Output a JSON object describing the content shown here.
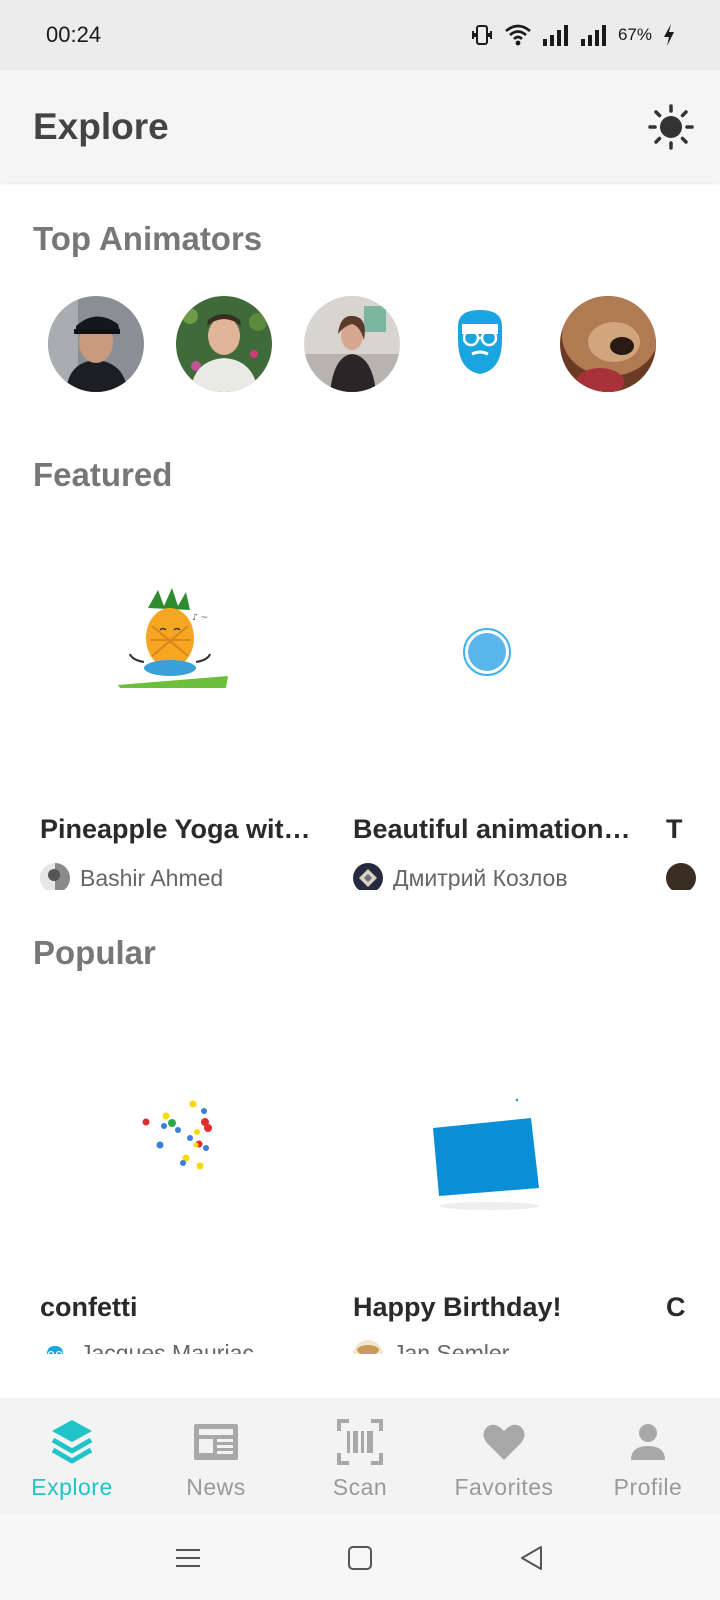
{
  "status_bar": {
    "time": "00:24",
    "battery": "67%"
  },
  "app_bar": {
    "title": "Explore",
    "theme_icon": "sun-icon"
  },
  "sections": {
    "top_animators": "Top Animators",
    "featured": "Featured",
    "popular": "Popular"
  },
  "featured": [
    {
      "title": "Pineapple Yoga wit…",
      "author": "Bashir Ahmed"
    },
    {
      "title": "Beautiful animation…",
      "author": "Дмитрий Козлов"
    },
    {
      "title": "T"
    }
  ],
  "popular": [
    {
      "title": "confetti",
      "author": "Jacques Mauriac"
    },
    {
      "title": "Happy Birthday!",
      "author": "Jan Semler"
    },
    {
      "title": "C"
    }
  ],
  "nav": [
    {
      "label": "Explore",
      "icon": "layers-icon",
      "active": true
    },
    {
      "label": "News",
      "icon": "newspaper-icon"
    },
    {
      "label": "Scan",
      "icon": "barcode-scan-icon"
    },
    {
      "label": "Favorites",
      "icon": "heart-icon"
    },
    {
      "label": "Profile",
      "icon": "person-icon"
    }
  ],
  "colors": {
    "accent": "#1fc3c8",
    "section_title": "#777777",
    "nav_inactive": "#9a9a9a"
  }
}
